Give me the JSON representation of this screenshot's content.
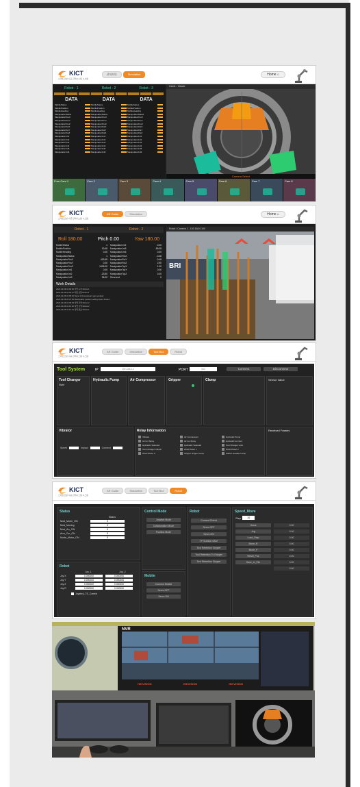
{
  "s1": {
    "brand": "KICT",
    "brand_sub": "스마트건설 시공 관제시스템 시스템",
    "tabs": [
      "관제화면",
      "Simulation"
    ],
    "home": "Home",
    "robot_tabs": [
      "Robot - 1",
      "Robot - 2",
      "Robot - 3"
    ],
    "data_title": "DATA",
    "sim_title": "Cam1 - Viewer",
    "cams": [
      "Free Cam 1",
      "Cam 2",
      "Cam 3",
      "Cam 4",
      "Cam 5",
      "Cam 6",
      "Cam 7",
      "Cam 8"
    ],
    "banner": "Camera Select",
    "rows": [
      "MobileStatus",
      "MobilePosition",
      "MobileHeading",
      "ManipulatorStatus",
      "ManipulatorPosX",
      "ManipulatorPosY",
      "ManipulatorPosZ",
      "ManipulatorRotX",
      "ManipulatorRotY",
      "ManipulatorRotZ",
      "ManipulatorJnt1",
      "ManipulatorJnt2",
      "ManipulatorJnt3",
      "ManipulatorJnt4",
      "ManipulatorJnt5",
      "ManipulatorJnt6"
    ]
  },
  "s2": {
    "tabs": [
      "AR Guide",
      "Simulation"
    ],
    "home": "Home",
    "robot_tabs": [
      "Robot - 1",
      "Robot - 2"
    ],
    "roll": "Roll 180.00",
    "pitch": "Pitch 0.00",
    "yaw": "Yaw 180.00",
    "data_left": [
      [
        "MobileStatus",
        "1"
      ],
      [
        "MobilePosition",
        "30.48"
      ],
      [
        "MobileHeading",
        "0.00"
      ],
      [
        "ManipulatorStatus",
        "1"
      ],
      [
        "ManipulatorPosX",
        "415.69"
      ],
      [
        "ManipulatorPosY",
        "0.00"
      ],
      [
        "ManipulatorPosZ",
        "1426.00"
      ],
      [
        "ManipulatorJnt1",
        "0.00"
      ],
      [
        "ManipulatorJnt2",
        "-23.50"
      ],
      [
        "ManipulatorJnt3",
        "36.02"
      ]
    ],
    "data_right": [
      [
        "ManipulatorJnt4",
        "0.00"
      ],
      [
        "ManipulatorJnt5",
        "-59.05"
      ],
      [
        "ManipulatorJnt6",
        "0.00"
      ],
      [
        "ManipulatorRotX",
        "-0.46"
      ],
      [
        "ManipulatorRotY",
        "-0.48"
      ],
      [
        "ManipulatorRotZ",
        "2.90"
      ],
      [
        "ManipulatorTcpX",
        "1.00"
      ],
      [
        "ManipulatorTcpY",
        "0.00"
      ],
      [
        "ManipulatorTcpZ",
        "0.00"
      ],
      [
        "Reserved",
        "0"
      ]
    ],
    "work_title": "Work Details",
    "work_rows": [
      "2023-02-06 10:00:00  작업 시작  Robot-1",
      "2023-02-06 10:02:11  작업 진행  Robot-1",
      "2023-02-06 10:05:32  Stand 1 Downstream was avoided.",
      "2023-02-06 10:07:45  Manipulator position settings were limited.",
      "2023-02-06 10:09:03  작업 진행  Robot-2",
      "2023-02-06 10:10:20  작업 진행  Robot-2",
      "2023-02-06 10:12:41  작업 완료  Robot-1"
    ],
    "cam_title": "Robot / Camera 1 - 192.168.0.100",
    "sign": "BRI"
  },
  "s3": {
    "tabs": [
      "AR Guide",
      "Simulation",
      "Tool Box",
      "Robot"
    ],
    "title": "Tool System",
    "ip_label": "IP",
    "ip_value": "192.168.0.1",
    "port_label": "PORT",
    "port_value": "502",
    "connect": "Connect",
    "disconnect": "Disconnect",
    "tool_changer": "Tool Changer",
    "state": "State",
    "hydraulic": "Hydraulic Pump",
    "air": "Air Compressor",
    "gripper": "Gripper",
    "clamp": "Clamp",
    "sensor": "Sensor Value",
    "vibrator": "Vibrator",
    "relay": "Relay Information",
    "received": "Received Frames",
    "relay_items": [
      "Vibrator",
      "Air Compressor",
      "Hydraulic Pump",
      "Air Ion Spray",
      "Air Ion Spray",
      "Hydraulic Ion Gun",
      "Hydraulic Solenoid",
      "Hydraulic Solenoid",
      "Tool Changer Lock",
      "Tool Changer Unlock",
      "Wrist Power 1",
      "Wrist Power 2",
      "Wrist Power 3",
      "Gripper Gripper Lamp",
      "Station Handler Lamp"
    ],
    "vib_labels": [
      "Speed",
      "Impact",
      "Connect"
    ]
  },
  "s4": {
    "tabs": [
      "AR Guide",
      "Simulation",
      "Tool Box",
      "Robot"
    ],
    "status_title": "Status",
    "status_col": "Status",
    "status_rows": [
      [
        "Mod_Motor_ON",
        "0"
      ],
      [
        "Mod_Moving",
        "0"
      ],
      [
        "Mod_Arr_ON",
        "0"
      ],
      [
        "Arm_Cur_ON",
        "0"
      ],
      [
        "Mode_Motor_ON",
        "0"
      ]
    ],
    "control_title": "Control Mode",
    "control_btns": [
      "Joystick Mode",
      "Collaboration Mode",
      "Position Mode"
    ],
    "mobile_title": "Mobile",
    "mobile_btns": [
      "Connect Mobile",
      "Servo OFF",
      "Servo ON"
    ],
    "robot_title": "Robot",
    "robot_btns": [
      "Connect Robot",
      "Servo OFF",
      "Servo ON",
      "TP Surface Save",
      "Tool Retention Gripper",
      "Tool Retention To Gripper",
      "Tool Retention Gripper"
    ],
    "speed_title": "Speed_Move",
    "step_label": "Step",
    "step_val": "10",
    "speed_btns": [
      "Home",
      "Jog",
      "Load_Step",
      "Move_R",
      "Move_P",
      "Reset_Pos",
      "Save_in_File"
    ],
    "speed_fields": [
      "0.00",
      "0.00",
      "0.00",
      "0.00",
      "0.00",
      "0.00",
      "0.00",
      "0.00"
    ],
    "robot2_title": "Robot",
    "joy_headers": [
      "Joy_1",
      "Joy_2"
    ],
    "joy_rows": [
      [
        "Joy X",
        "0.000000",
        "0.000000"
      ],
      [
        "Joy Y",
        "0.000000",
        "0.000000"
      ],
      [
        "Joy Z",
        "0.000000",
        "0.000000"
      ],
      [
        "Joy R",
        "0.000000",
        "0.000000"
      ]
    ],
    "joy_check": "Joystick_TS_Control"
  },
  "s5": {
    "nvr": "NVR",
    "brand_strip": [
      "HIKVISION",
      "HIKVISION",
      "HIKVISION"
    ]
  }
}
